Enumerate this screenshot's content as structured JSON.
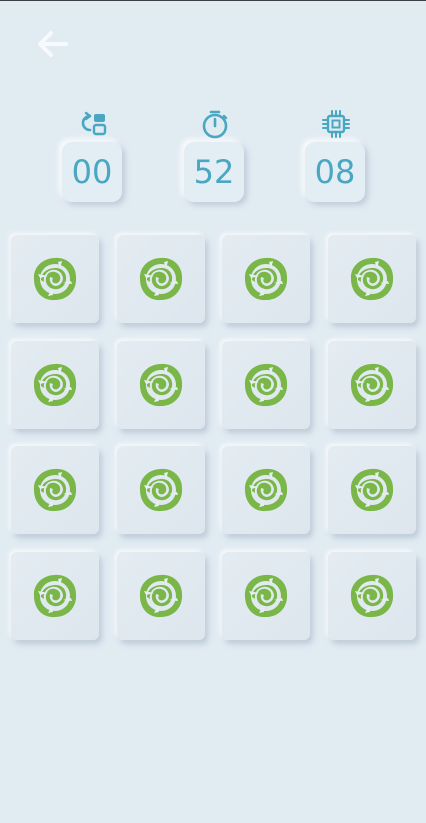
{
  "header": {
    "back_icon": "arrow-left-icon"
  },
  "stats": {
    "flips": {
      "icon": "flip-cards-icon",
      "value": "00"
    },
    "timer": {
      "icon": "stopwatch-icon",
      "value": "52"
    },
    "cpu": {
      "icon": "cpu-chip-icon",
      "value": "08"
    }
  },
  "colors": {
    "background": "#e1ebf2",
    "accent": "#4aa7c1",
    "card_back": "#7ab648"
  },
  "board": {
    "rows": 4,
    "columns": 4,
    "cards": [
      {
        "state": "face-down"
      },
      {
        "state": "face-down"
      },
      {
        "state": "face-down"
      },
      {
        "state": "face-down"
      },
      {
        "state": "face-down"
      },
      {
        "state": "face-down"
      },
      {
        "state": "face-down"
      },
      {
        "state": "face-down"
      },
      {
        "state": "face-down"
      },
      {
        "state": "face-down"
      },
      {
        "state": "face-down"
      },
      {
        "state": "face-down"
      },
      {
        "state": "face-down"
      },
      {
        "state": "face-down"
      },
      {
        "state": "face-down"
      },
      {
        "state": "face-down"
      }
    ]
  }
}
